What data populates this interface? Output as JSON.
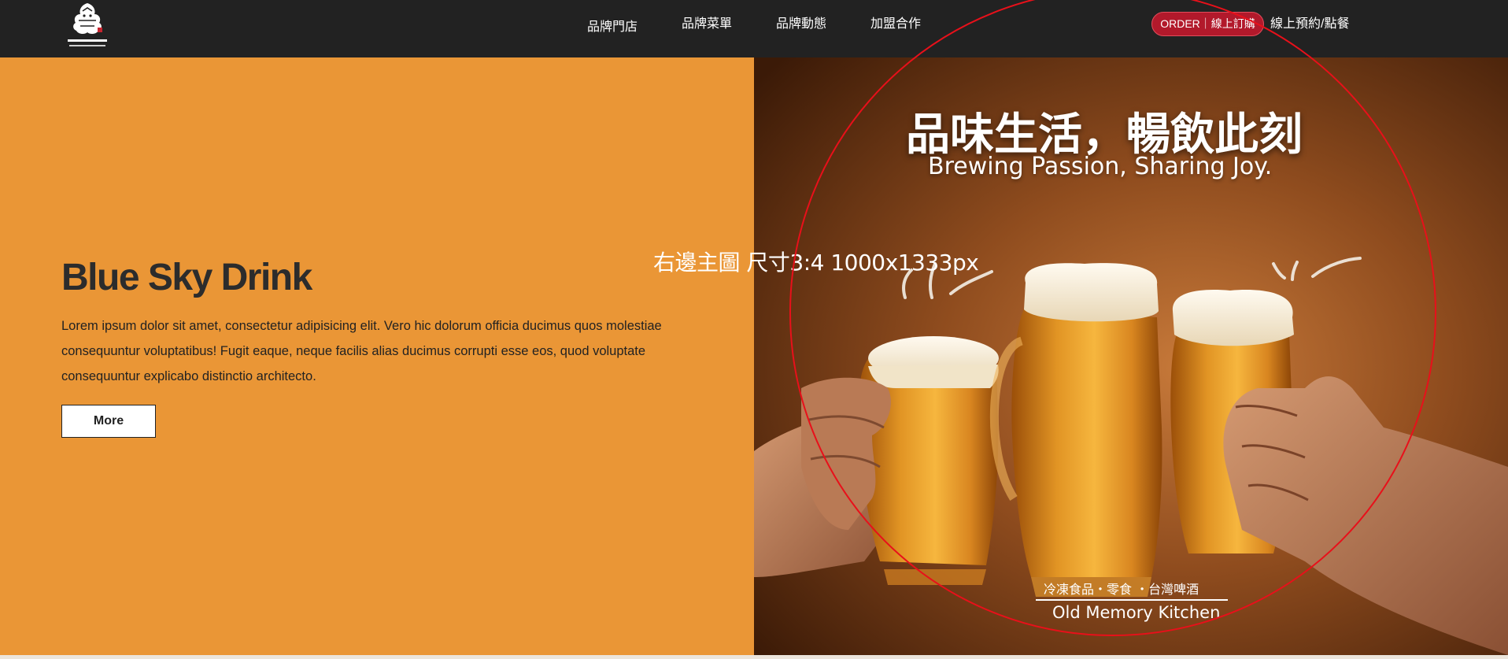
{
  "header": {
    "nav_items": [
      {
        "label": "品牌門店"
      },
      {
        "label": "品牌菜單"
      },
      {
        "label": "品牌動態"
      },
      {
        "label": "加盟合作"
      }
    ],
    "order_button": "ORDER｜線上訂購",
    "reserve_link": "線上預約/點餐",
    "logo_icon": "brand-logo-icon"
  },
  "hero": {
    "title": "Blue Sky Drink",
    "description": "Lorem ipsum dolor sit amet, consectetur adipisicing elit. Vero hic dolorum officia ducimus quos molestiae consequuntur voluptatibus! Fugit eaque, neque facilis alias ducimus corrupti esse eos, quod voluptate consequuntur explicabo distinctio architecto.",
    "more_button": "More"
  },
  "hero_image": {
    "headline_cn": "品味生活，暢飲此刻",
    "headline_en": "Brewing Passion, Sharing Joy.",
    "tagline_cn": "冷凍食品・零食 ・台灣啤酒",
    "tagline_en": "Old Memory Kitchen"
  },
  "overlay_note": "右邊主圖 尺寸3:4  1000x1333px",
  "colors": {
    "header_bg": "#222222",
    "panel_orange": "#ea9636",
    "order_red": "#b2192b",
    "annotation_red": "#e8101a"
  }
}
